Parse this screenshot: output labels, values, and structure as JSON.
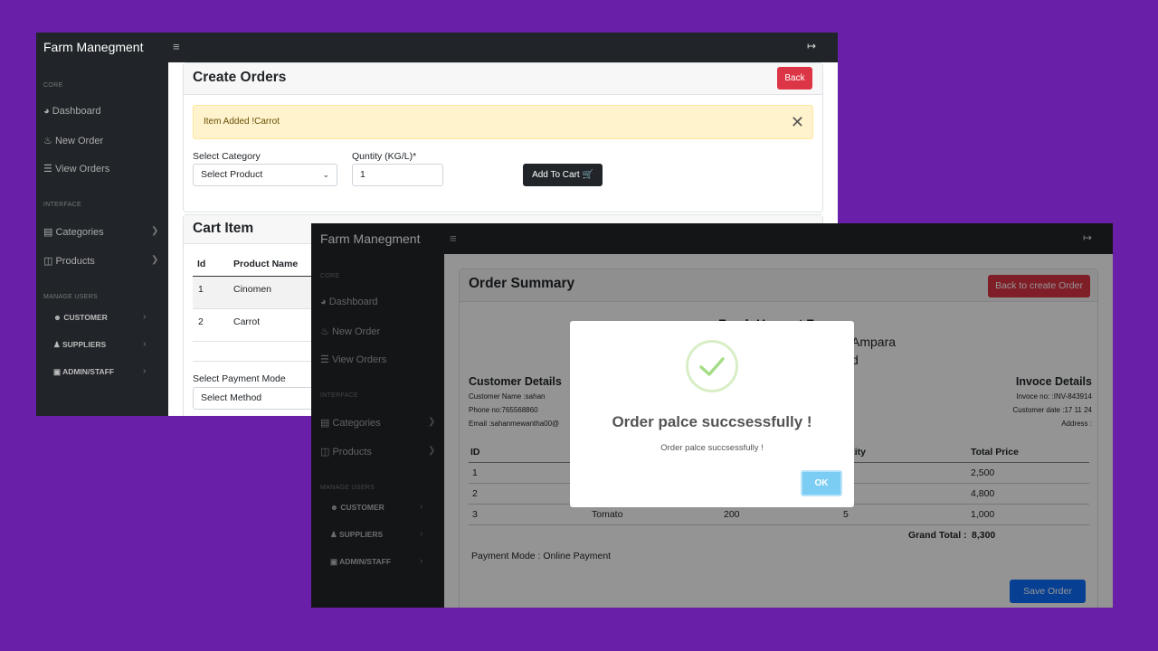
{
  "window1": {
    "brand": "Farm Manegment",
    "sidenav": {
      "core_heading": "CORE",
      "dashboard": "Dashboard",
      "new_order": "New Order",
      "view_orders": "View Orders",
      "interface_heading": "INTERFACE",
      "categories": "Categories",
      "products": "Products",
      "manage_users_heading": "MANAGE USERS",
      "customer": "CUSTOMER",
      "suppliers": "SUPPLIERS",
      "admin_staff": "ADMIN/STAFF"
    },
    "create_orders": {
      "title": "Create Orders",
      "back_label": "Back",
      "alert_text": "Item Added !Carrot",
      "category_label": "Select Category",
      "category_value": "Select Product",
      "quantity_label": "Quntity (KG/L)*",
      "quantity_value": "1",
      "add_to_cart_label": "Add To Cart"
    },
    "cart": {
      "title": "Cart Item",
      "columns": [
        "Id",
        "Product Name"
      ],
      "rows": [
        {
          "id": "1",
          "name": "Cinomen"
        },
        {
          "id": "2",
          "name": "Carrot"
        }
      ],
      "payment_label": "Select Payment Mode",
      "payment_value": "Select Method"
    }
  },
  "window2": {
    "brand": "Farm Manegment",
    "sidenav": {
      "core_heading": "CORE",
      "dashboard": "Dashboard",
      "new_order": "New Order",
      "view_orders": "View Orders",
      "interface_heading": "INTERFACE",
      "categories": "Categories",
      "products": "Products",
      "manage_users_heading": "MANAGE USERS",
      "customer": "CUSTOMER",
      "suppliers": "SUPPLIERS",
      "admin_staff": "ADMIN/STAFF"
    },
    "summary": {
      "title": "Order Summary",
      "back_label": "Back to create Order",
      "farm_name": "Fresh Harvest Farm",
      "farm_address_fragment": "Ampara",
      "farm_line_fragment": "d",
      "customer_heading": "Customer Details",
      "customer_name": "Customer Name :sahan",
      "customer_phone": "Phone no:765568860",
      "customer_email": "Email :sahanmewantha00@",
      "invoice_heading": "Invoce Details",
      "invoice_no": "Invoce no: :INV-843914",
      "invoice_date": "Customer date :17 11 24",
      "invoice_address": "Address :",
      "columns": {
        "id": "ID",
        "quantity": "antity",
        "total": "Total Price"
      },
      "rows": [
        {
          "id": "1",
          "total": "2,500"
        },
        {
          "id": "2",
          "total": "4,800"
        },
        {
          "id": "3",
          "name": "Tomato",
          "price": "200",
          "qty": "5",
          "total": "1,000"
        }
      ],
      "grand_total_label": "Grand Total :",
      "grand_total_value": "8,300",
      "payment_mode": "Payment Mode : Online Payment",
      "save_label": "Save Order"
    }
  },
  "modal": {
    "title": "Order palce succsessfully !",
    "text": "Order palce succsessfully !",
    "ok_label": "OK"
  },
  "colors": {
    "background": "#6a1fa8",
    "navbar": "#212529",
    "danger": "#dc3545",
    "primary": "#0d6efd",
    "success_check": "#a5dc86",
    "ok_button": "#7ccdf4"
  }
}
